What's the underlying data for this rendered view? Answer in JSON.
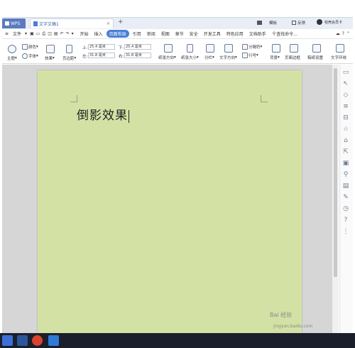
{
  "titlebar": {
    "app_tab": "WPS",
    "doc_tab": "文字文稿1",
    "add_tab": "+",
    "right_a": "模板",
    "right_b": "反馈",
    "account": "稻壳会员卡"
  },
  "menu": {
    "file": "文件",
    "items": [
      "开始",
      "插入",
      "页面布局",
      "引用",
      "审阅",
      "视图",
      "章节",
      "安全",
      "开发工具",
      "特色应用",
      "文档助手"
    ],
    "active_index": 2,
    "search": "查找命令..."
  },
  "ribbon": {
    "theme": "主题",
    "colors": "颜色",
    "fonts": "字体",
    "effects": "效果",
    "margins": "页边距",
    "top_label": "上:",
    "top_value": "25.4 毫米",
    "bottom_label": "下:",
    "bottom_value": "25.4 毫米",
    "left_label": "左:",
    "left_value": "31.8 毫米",
    "right_label": "右:",
    "right_value": "31.8 毫米",
    "orientation": "纸张方向",
    "size": "纸张大小",
    "columns": "分栏",
    "text_dir": "文字方向",
    "line_num": "行号",
    "breaks": "分隔符",
    "background": "背景",
    "page_border": "页面边框",
    "watermark_setting": "稿纸设置",
    "wrap": "文字环绕"
  },
  "document": {
    "text": "倒影效果"
  },
  "watermark": {
    "logo": "Bai 经验",
    "url": "jingyan.baidu.com"
  },
  "colors": {
    "page": "#d4e1a5",
    "accent": "#4a7fd6",
    "taskbar": "#1b1f2b"
  }
}
